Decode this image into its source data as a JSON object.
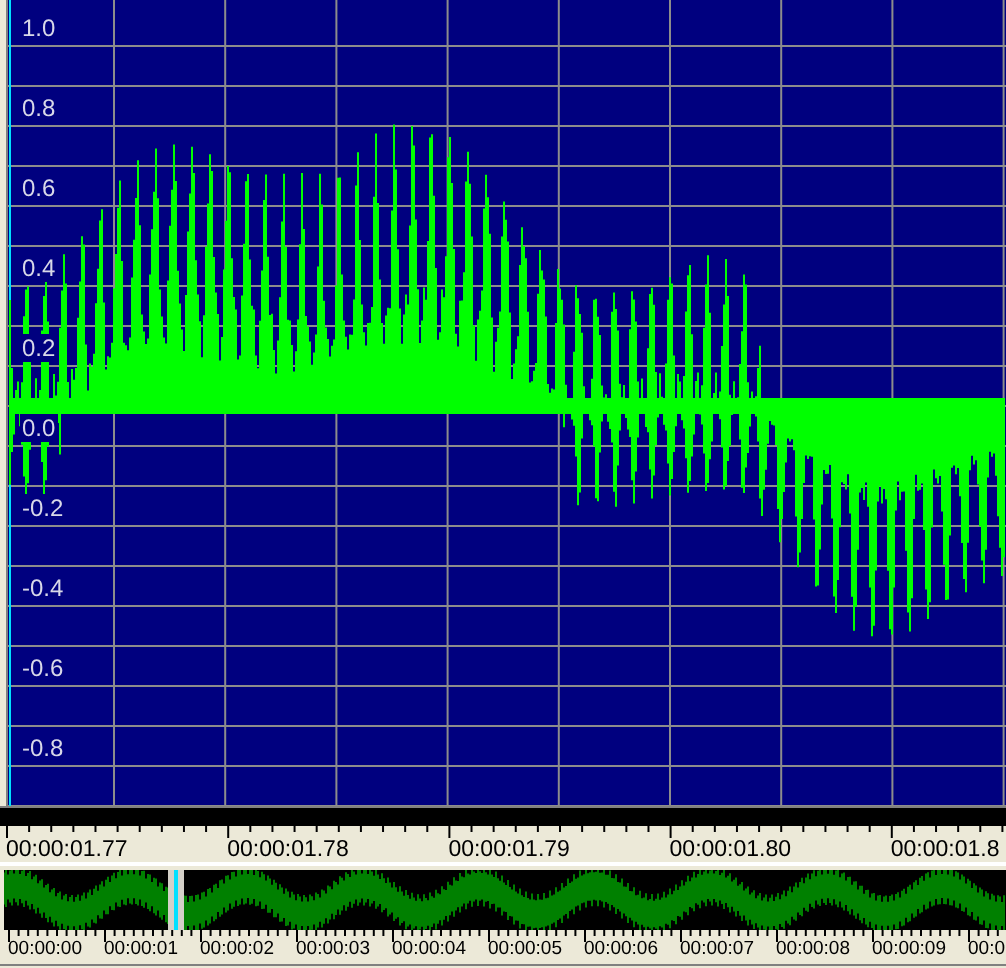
{
  "waveform": {
    "amplitude_labels": [
      "1.0",
      "0.8",
      "0.6",
      "0.4",
      "0.2",
      "0.0",
      "-0.2",
      "-0.4",
      "-0.6",
      "-0.8"
    ]
  },
  "time_ruler": {
    "labels": [
      "00:00:01.77",
      "00:00:01.78",
      "00:00:01.79",
      "00:00:01.80",
      "00:00:01.8"
    ]
  },
  "overview": {
    "labels": [
      "00:00:00",
      "00:00:01",
      "00:00:02",
      "00:00:03",
      "00:00:04",
      "00:00:05",
      "00:00:06",
      "00:00:07",
      "00:00:08",
      "00:00:09",
      "00:0"
    ]
  }
}
